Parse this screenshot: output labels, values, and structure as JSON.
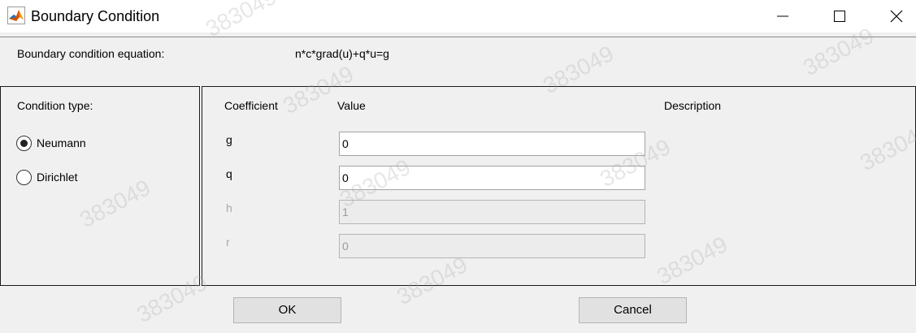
{
  "window": {
    "title": "Boundary Condition",
    "controls": [
      "minimize",
      "maximize",
      "close"
    ]
  },
  "equation": {
    "label": "Boundary condition equation:",
    "value": "n*c*grad(u)+q*u=g"
  },
  "condition_type": {
    "label": "Condition type:",
    "options": [
      {
        "label": "Neumann",
        "selected": true
      },
      {
        "label": "Dirichlet",
        "selected": false
      }
    ]
  },
  "table": {
    "headers": {
      "coefficient": "Coefficient",
      "value": "Value",
      "description": "Description"
    },
    "rows": [
      {
        "coefficient": "g",
        "value": "0",
        "enabled": true
      },
      {
        "coefficient": "q",
        "value": "0",
        "enabled": true
      },
      {
        "coefficient": "h",
        "value": "1",
        "enabled": false
      },
      {
        "coefficient": "r",
        "value": "0",
        "enabled": false
      }
    ]
  },
  "buttons": {
    "ok": "OK",
    "cancel": "Cancel"
  },
  "watermark": "383049",
  "colors": {
    "background": "#f0f0f0",
    "titlebar": "#ffffff",
    "disabled_text": "#a8a8a8"
  }
}
